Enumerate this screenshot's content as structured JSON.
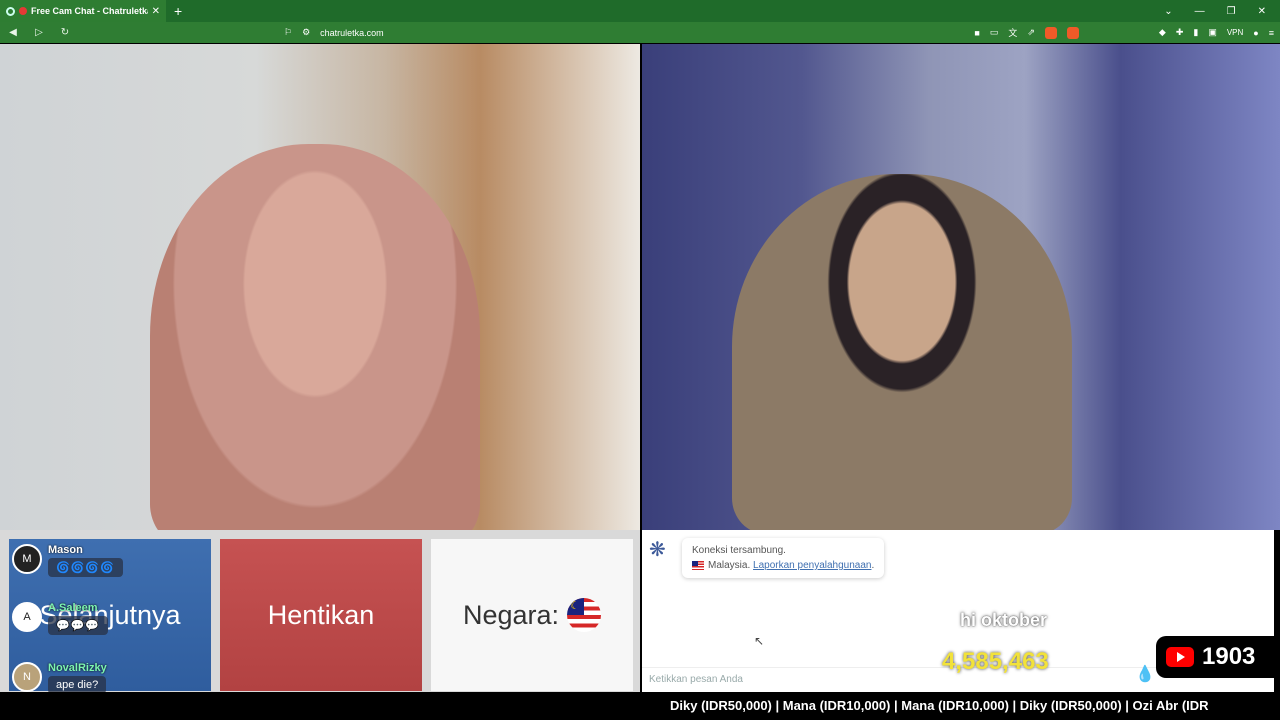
{
  "browser": {
    "tab_title": "Free Cam Chat - Chatruletka",
    "close_glyph": "✕",
    "new_tab_glyph": "+",
    "url": "chatruletka.com",
    "vpn_label": "VPN",
    "window_controls": [
      "⌄",
      "—",
      "❐",
      "✕"
    ]
  },
  "controls": {
    "next_label": "Selanjutnya",
    "stop_label": "Hentikan",
    "country_label": "Negara:"
  },
  "overlay_chat": [
    {
      "user": "Mason",
      "avatar": "M",
      "message": "🌀🌀🌀🌀"
    },
    {
      "user": "A.Saleem",
      "avatar": "A",
      "message": "💬💬💬"
    },
    {
      "user": "NovalRizky",
      "avatar": "N",
      "message": "ape die?"
    }
  ],
  "chat": {
    "system_line1": "Koneksi tersambung.",
    "system_country": "Malaysia.",
    "system_link": "Laporkan penyalahgunaan",
    "input_placeholder": "Ketikkan pesan Anda"
  },
  "stream_overlay": {
    "caption": "hi oktober",
    "counter": "4,585,463",
    "viewer_count": "1903"
  },
  "ticker": {
    "text": "Diky (IDR50,000) | Mana (IDR10,000) | Mana (IDR10,000) | Diky (IDR50,000) | Ozi Abr (IDR"
  },
  "colors": {
    "next_button": "#3f6fb0",
    "stop_button": "#c65252",
    "browser_chrome": "#2f7d33",
    "counter": "#f2e23a"
  }
}
